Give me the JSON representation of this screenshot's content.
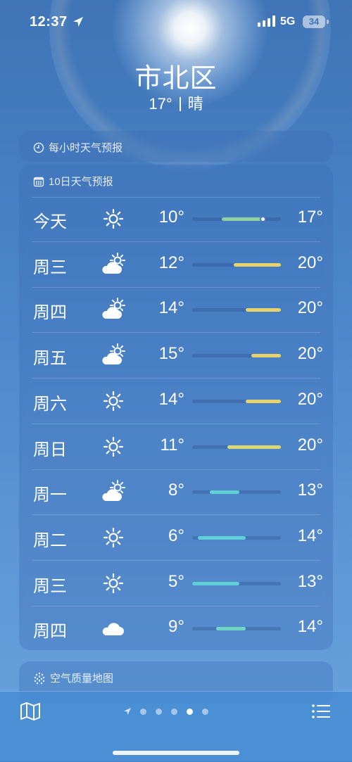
{
  "status": {
    "time": "12:37",
    "network": "5G",
    "battery": "34"
  },
  "location": {
    "city": "市北区",
    "temperature": "17°",
    "condition": "晴"
  },
  "hourly": {
    "title": "每小时天气预报"
  },
  "forecast": {
    "title": "10日天气预报",
    "scale": {
      "min": 5,
      "max": 20
    },
    "current_temp": 17,
    "days": [
      {
        "day": "今天",
        "icon": "sun-icon",
        "low": "10°",
        "high": "17°",
        "low_v": 10,
        "high_v": 17,
        "color": "#8fd19e",
        "current": true
      },
      {
        "day": "周三",
        "icon": "partly-cloudy-icon",
        "low": "12°",
        "high": "20°",
        "low_v": 12,
        "high_v": 20,
        "color": "#e6d46a"
      },
      {
        "day": "周四",
        "icon": "partly-cloudy-icon",
        "low": "14°",
        "high": "20°",
        "low_v": 14,
        "high_v": 20,
        "color": "#e6d46a"
      },
      {
        "day": "周五",
        "icon": "partly-cloudy-icon",
        "low": "15°",
        "high": "20°",
        "low_v": 15,
        "high_v": 20,
        "color": "#e6d46a"
      },
      {
        "day": "周六",
        "icon": "sun-icon",
        "low": "14°",
        "high": "20°",
        "low_v": 14,
        "high_v": 20,
        "color": "#e6d46a"
      },
      {
        "day": "周日",
        "icon": "sun-icon",
        "low": "11°",
        "high": "20°",
        "low_v": 11,
        "high_v": 20,
        "color": "#d9d873"
      },
      {
        "day": "周一",
        "icon": "partly-cloudy-icon",
        "low": "8°",
        "high": "13°",
        "low_v": 8,
        "high_v": 13,
        "color": "#5fd0d6"
      },
      {
        "day": "周二",
        "icon": "sun-icon",
        "low": "6°",
        "high": "14°",
        "low_v": 6,
        "high_v": 14,
        "color": "#5fd0d6"
      },
      {
        "day": "周三",
        "icon": "sun-icon",
        "low": "5°",
        "high": "13°",
        "low_v": 5,
        "high_v": 13,
        "color": "#5fd0d6"
      },
      {
        "day": "周四",
        "icon": "cloud-icon",
        "low": "9°",
        "high": "14°",
        "low_v": 9,
        "high_v": 14,
        "color": "#6fd6c6"
      }
    ]
  },
  "air_quality": {
    "title": "空气质量地图"
  },
  "pager": {
    "count": 6,
    "active": 4
  }
}
